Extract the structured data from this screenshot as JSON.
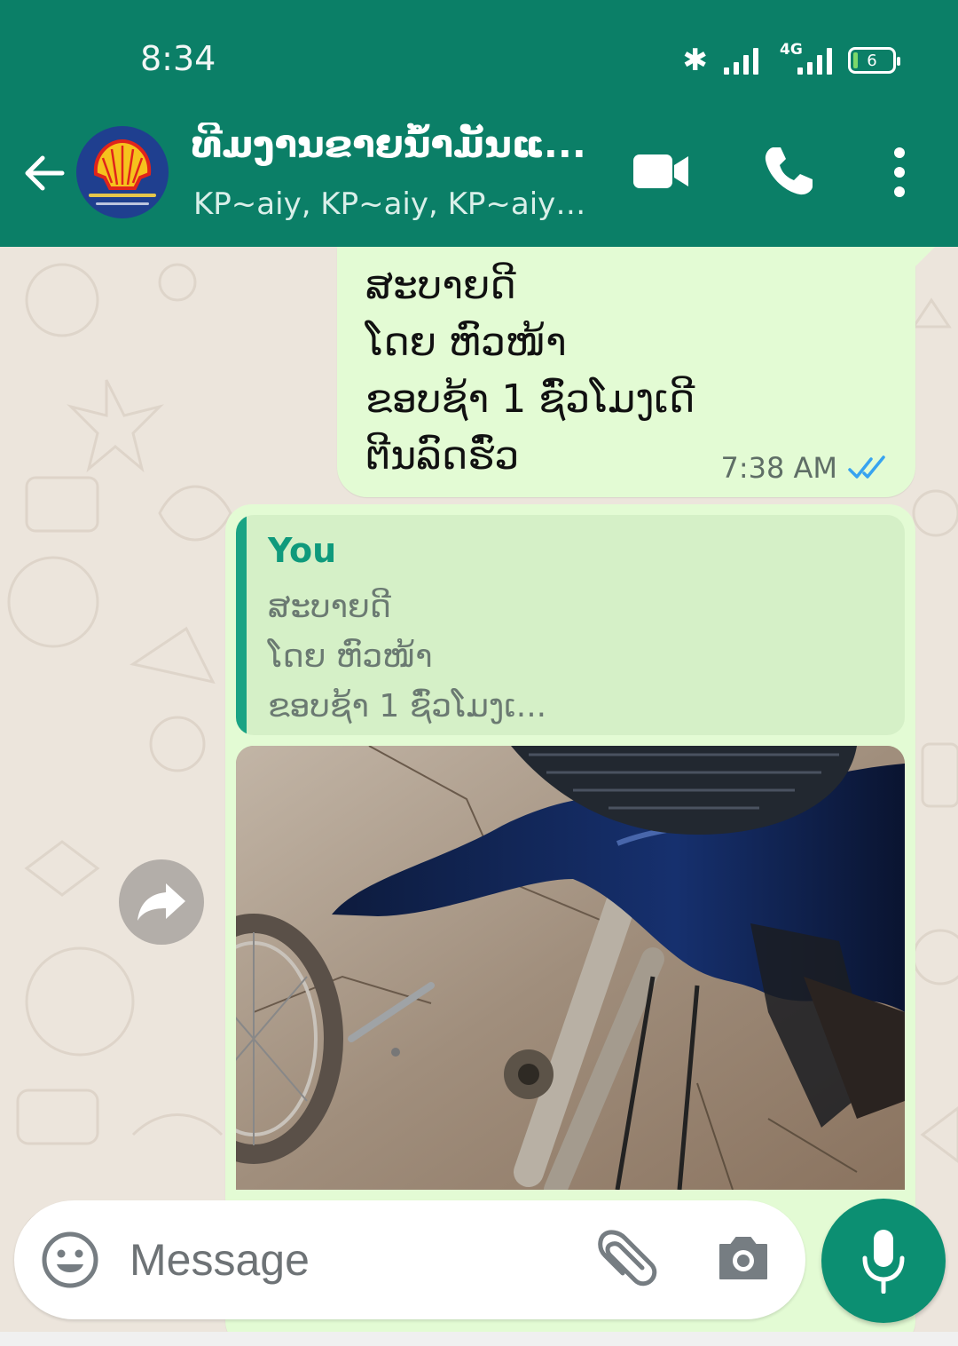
{
  "status_bar": {
    "time": "8:34",
    "network_label": "4G",
    "battery_level": "6"
  },
  "header": {
    "title": "ທີມງານຂາຍນ້ຳມັນແ...",
    "subtitle": "KP~aiy, KP~aiy, KP~aiy,...",
    "icons": [
      "back-arrow-icon",
      "video-call-icon",
      "voice-call-icon",
      "more-options-icon"
    ],
    "brand_color": "#0b7f67"
  },
  "messages": [
    {
      "type": "outgoing-text",
      "text": "ສະບາຍດີ\nໂດຍ ຫົວໜ້າ\nຂອບຊ້າ 1 ຊົ່ວໂມງເດີ\nຕີນລົດຮົ່ວ",
      "time": "7:38 AM",
      "status": "read"
    },
    {
      "type": "outgoing-image-reply",
      "quote_author": "You",
      "quote_text": "ສະບາຍດີ\nໂດຍ ຫົວໜ້າ\nຂອບຊ້າ 1 ຊົ່ວໂມງເ...",
      "image_subject": "motorcycle front fork with removed wheel"
    }
  ],
  "composer": {
    "placeholder": "Message",
    "icons": [
      "emoji-icon",
      "attach-icon",
      "camera-icon",
      "mic-icon"
    ]
  }
}
